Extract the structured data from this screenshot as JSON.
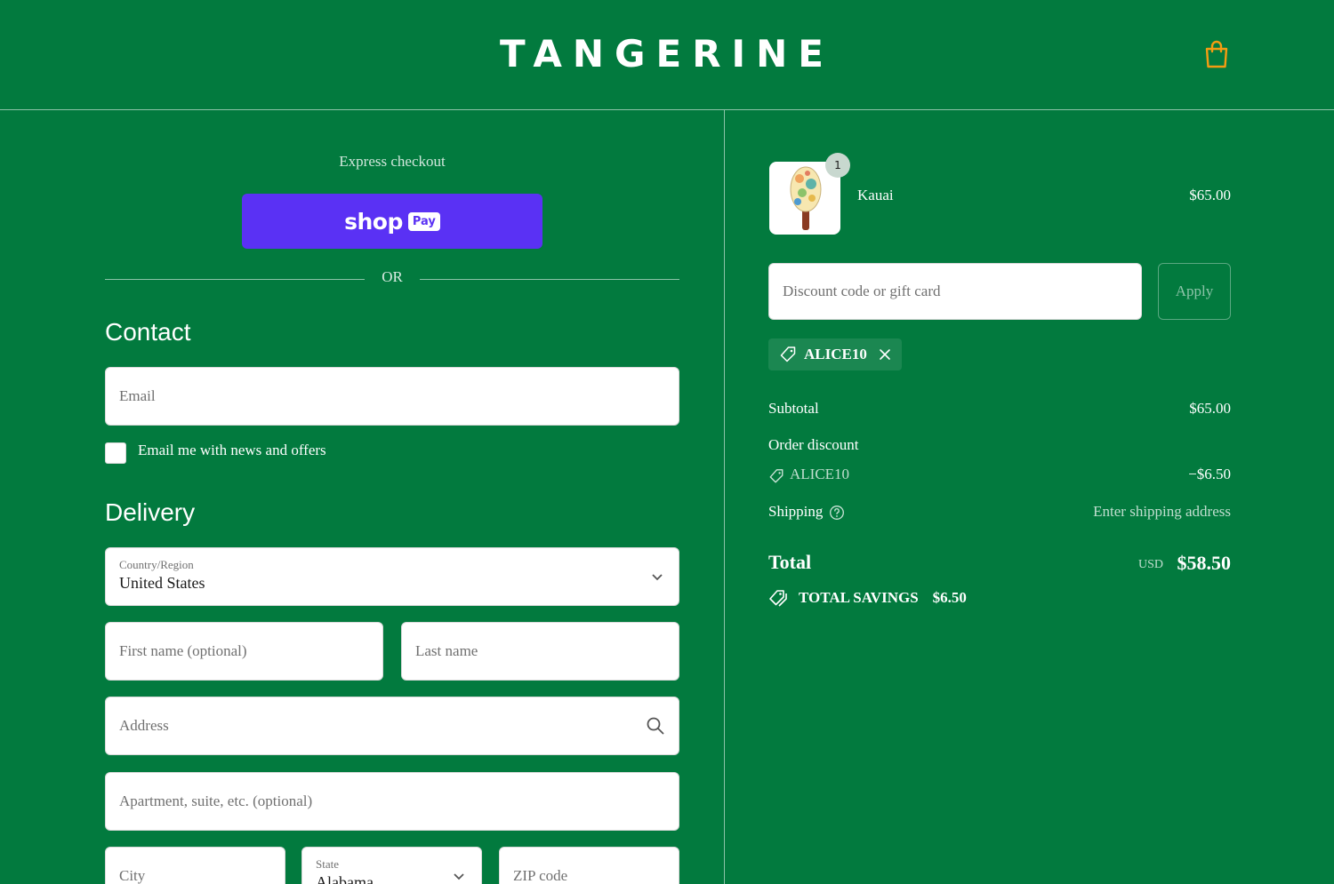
{
  "header": {
    "logo": "TANGERINE",
    "cart_icon": "shopping-bag-icon",
    "cart_icon_color": "#f39c12"
  },
  "colors": {
    "background": "#027a3e",
    "shop_pay": "#5a31f4"
  },
  "express": {
    "title": "Express checkout",
    "shop_word": "shop",
    "pay_chip": "Pay",
    "or": "OR"
  },
  "contact": {
    "heading": "Contact",
    "email_placeholder": "Email",
    "newsletter_label": "Email me with news and offers",
    "newsletter_checked": false
  },
  "delivery": {
    "heading": "Delivery",
    "country_label": "Country/Region",
    "country_value": "United States",
    "first_name_placeholder": "First name (optional)",
    "last_name_placeholder": "Last name",
    "address_placeholder": "Address",
    "apartment_placeholder": "Apartment, suite, etc. (optional)",
    "city_placeholder": "City",
    "state_label": "State",
    "state_value": "Alabama",
    "zip_placeholder": "ZIP code"
  },
  "summary": {
    "product": {
      "name": "Kauai",
      "price": "$65.00",
      "quantity": "1"
    },
    "discount_placeholder": "Discount code or gift card",
    "apply_label": "Apply",
    "applied_code": "ALICE10",
    "subtotal_label": "Subtotal",
    "subtotal_value": "$65.00",
    "order_discount_label": "Order discount",
    "discount_code": "ALICE10",
    "discount_value": "−$6.50",
    "shipping_label": "Shipping",
    "shipping_value": "Enter shipping address",
    "total_label": "Total",
    "total_currency": "USD",
    "total_value": "$58.50",
    "savings_label": "TOTAL SAVINGS",
    "savings_value": "$6.50"
  }
}
